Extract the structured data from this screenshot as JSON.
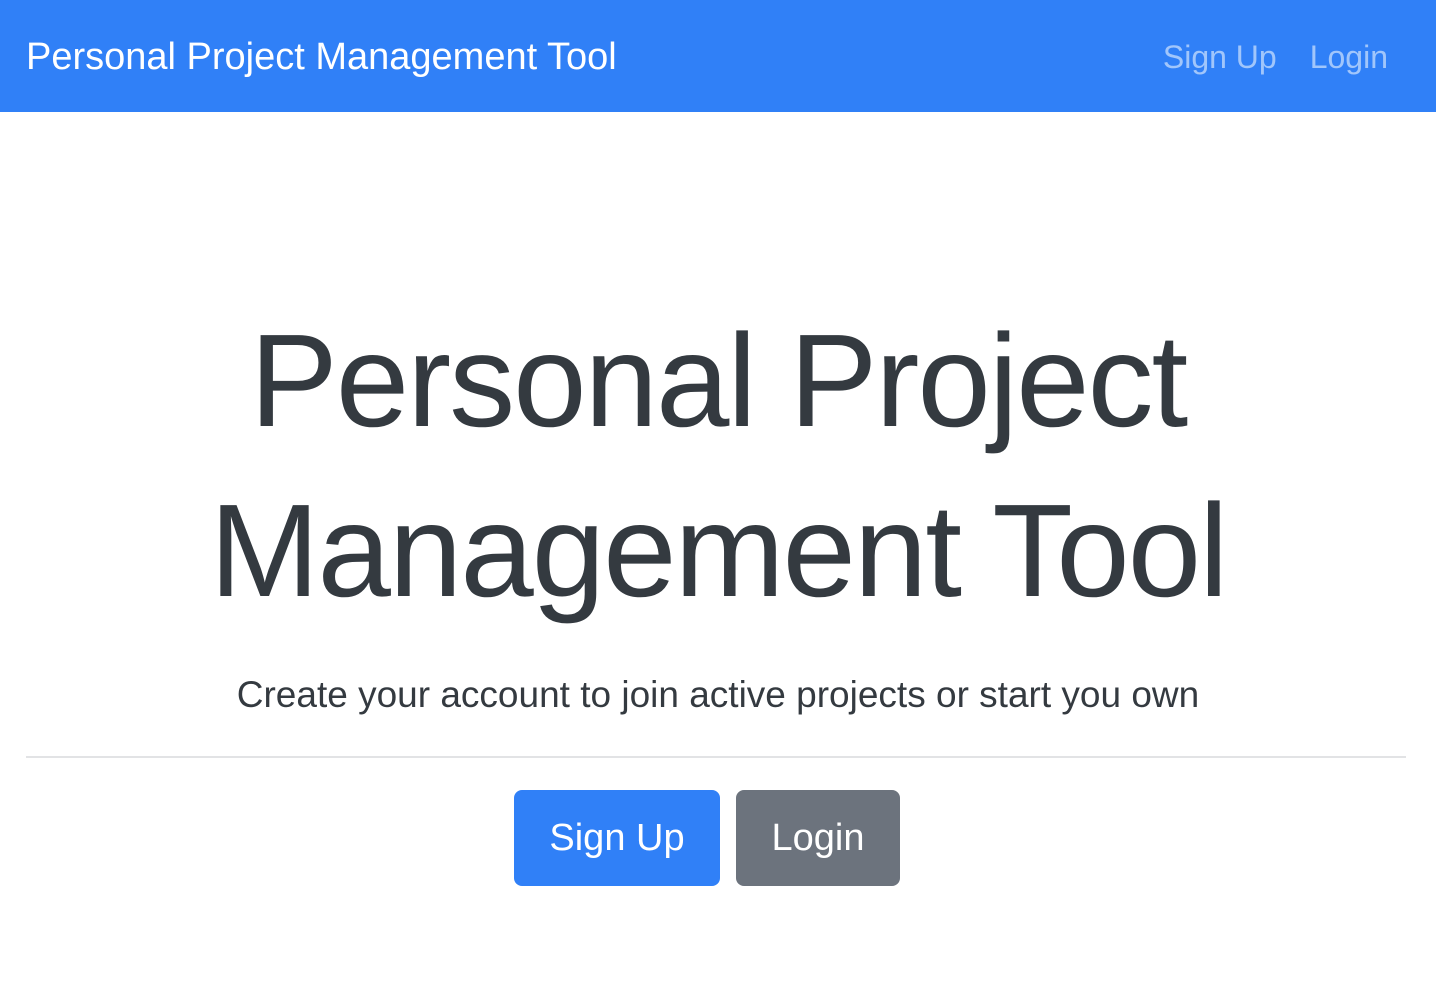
{
  "navbar": {
    "brand": "Personal Project Management Tool",
    "links": [
      {
        "label": "Sign Up"
      },
      {
        "label": "Login"
      }
    ]
  },
  "hero": {
    "title_line1": "Personal Project",
    "title_line2": "Management Tool",
    "subtitle": "Create your account to join active projects or start you own",
    "primary_button": "Sign Up",
    "secondary_button": "Login"
  },
  "colors": {
    "navbar_background": "#3080f7",
    "primary": "#3080f7",
    "secondary": "#6c737d",
    "heading_text": "#343a40"
  }
}
